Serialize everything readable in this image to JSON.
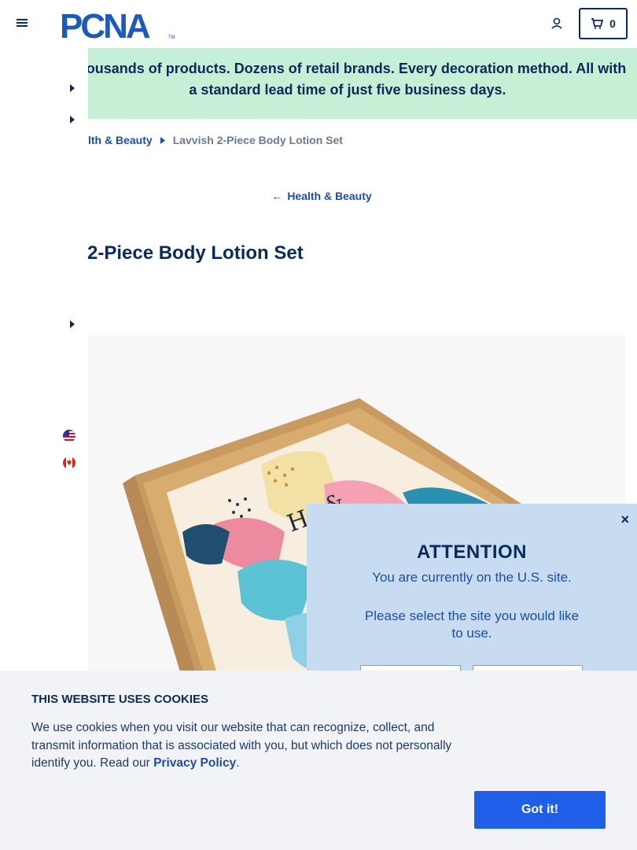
{
  "header": {
    "logo_text": "PCNA",
    "logo_tm": "TM",
    "cart_count": "0"
  },
  "banner": {
    "text": "Thousands of products. Dozens of retail brands. Every decoration method. All with a standard lead time of just five business days."
  },
  "breadcrumb": {
    "category": "lth & Beauty",
    "current": "Lavvish 2-Piece Body Lotion Set"
  },
  "back_link": {
    "arrow": "←",
    "label": "Health & Beauty"
  },
  "product": {
    "title": "2-Piece Body Lotion Set"
  },
  "attention_modal": {
    "close": "×",
    "title": "ATTENTION",
    "current_site": "You are currently on the U.S. site.",
    "prompt": "Please select the site you would like to use."
  },
  "cookie_banner": {
    "title": "THIS WEBSITE USES COOKIES",
    "text": "We use cookies when you visit our website that can recognize, collect, and transmit information that is associated with you, but which does not personally identify you. Read our ",
    "link": "Privacy Policy",
    "period": ".",
    "button": "Got it!"
  },
  "colors": {
    "navy": "#0a2a5c",
    "link_blue": "#1e4ea1",
    "banner_green": "#c6f0d6",
    "modal_blue": "#c8dcf1",
    "cookie_button": "#1f5ee8"
  }
}
